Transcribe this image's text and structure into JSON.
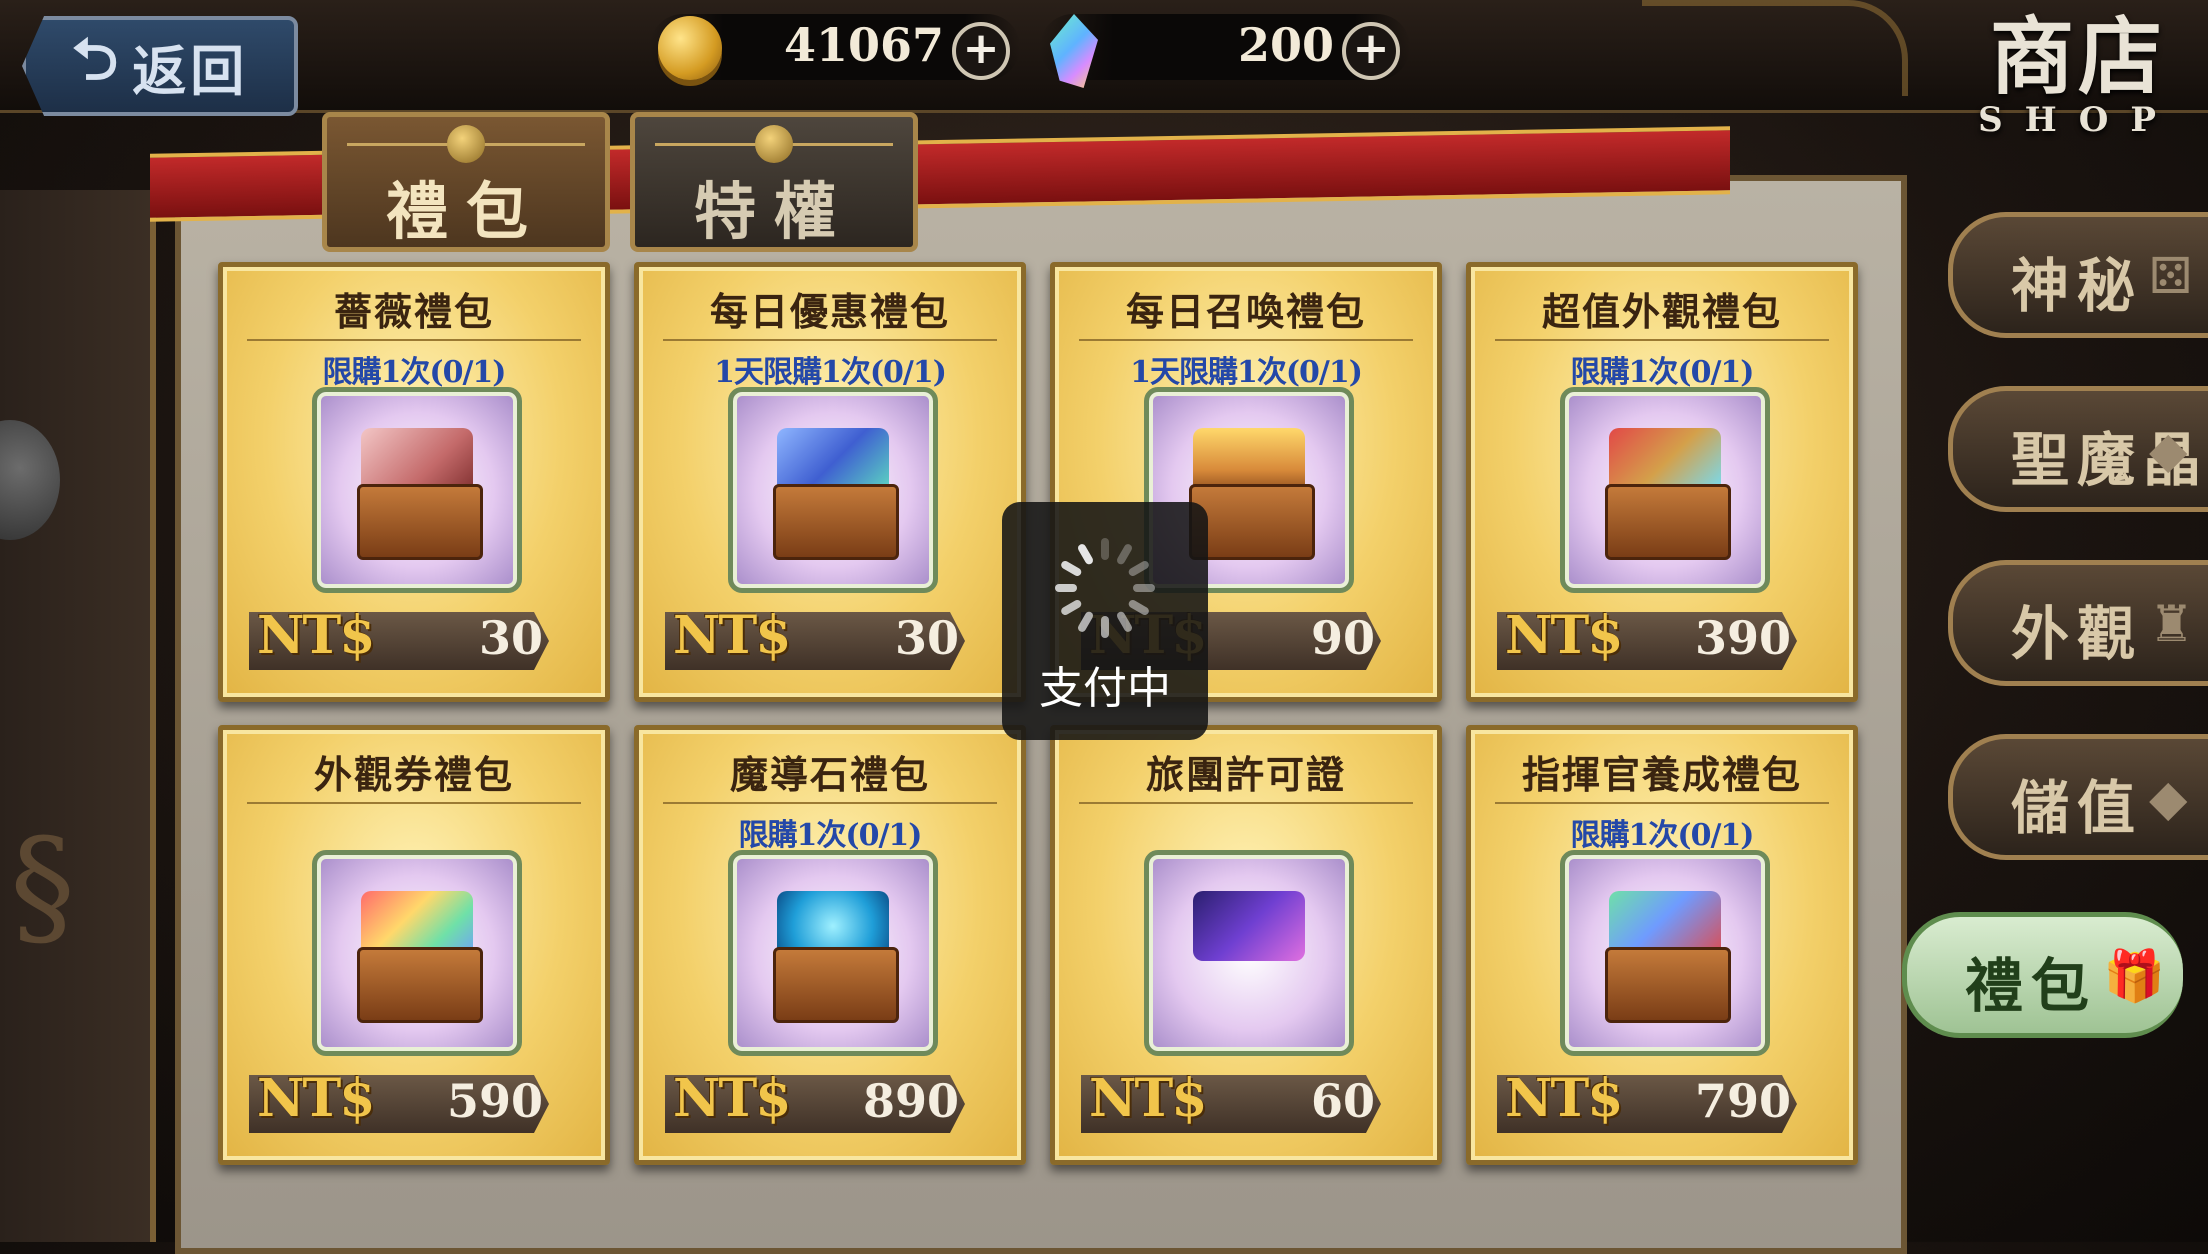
{
  "header": {
    "back_label": "返回",
    "gold": {
      "icon": "coin-icon",
      "amount": "41067"
    },
    "gem": {
      "icon": "crystal-icon",
      "amount": "200"
    },
    "title_zh": "商店",
    "title_en": "SHOP"
  },
  "tabs": [
    {
      "label": "禮包",
      "active": true
    },
    {
      "label": "特權",
      "active": false
    }
  ],
  "cards": [
    {
      "title": "薔薇禮包",
      "limit": "限購1次(0/1)",
      "currency": "NT$",
      "price": "30",
      "art": "rose-chest"
    },
    {
      "title": "每日優惠禮包",
      "limit": "1天限購1次(0/1)",
      "currency": "NT$",
      "price": "30",
      "art": "card-crystal-chest"
    },
    {
      "title": "每日召喚禮包",
      "limit": "1天限購1次(0/1)",
      "currency": "NT$",
      "price": "90",
      "art": "burger-chest"
    },
    {
      "title": "超值外觀禮包",
      "limit": "限購1次(0/1)",
      "currency": "NT$",
      "price": "390",
      "art": "costume-card-chest"
    },
    {
      "title": "外觀券禮包",
      "limit": "",
      "currency": "NT$",
      "price": "590",
      "art": "ticket-chest"
    },
    {
      "title": "魔導石禮包",
      "limit": "限購1次(0/1)",
      "currency": "NT$",
      "price": "890",
      "art": "magic-stone-chest"
    },
    {
      "title": "旅團許可證",
      "limit": "",
      "currency": "NT$",
      "price": "60",
      "art": "permit-card"
    },
    {
      "title": "指揮官養成禮包",
      "limit": "限購1次(0/1)",
      "currency": "NT$",
      "price": "790",
      "art": "commander-chest"
    }
  ],
  "side_menu": [
    {
      "label": "神秘",
      "icon": "dice-icon",
      "glyph": "⚄",
      "active": false
    },
    {
      "label": "聖魔晶",
      "icon": "crystal-icon",
      "glyph": "◆",
      "active": false
    },
    {
      "label": "外觀",
      "icon": "costume-icon",
      "glyph": "♜",
      "active": false
    },
    {
      "label": "儲值",
      "icon": "gem-icon",
      "glyph": "◆",
      "active": false
    },
    {
      "label": "禮包",
      "icon": "gift-icon",
      "glyph": "🎁",
      "active": true
    }
  ],
  "overlay": {
    "text": "支付中"
  },
  "colors": {
    "card_gold": "#f3d06a",
    "limit_blue": "#2448a8",
    "price_gold": "#f1c54b",
    "ribbon_red": "#c22a2a"
  }
}
